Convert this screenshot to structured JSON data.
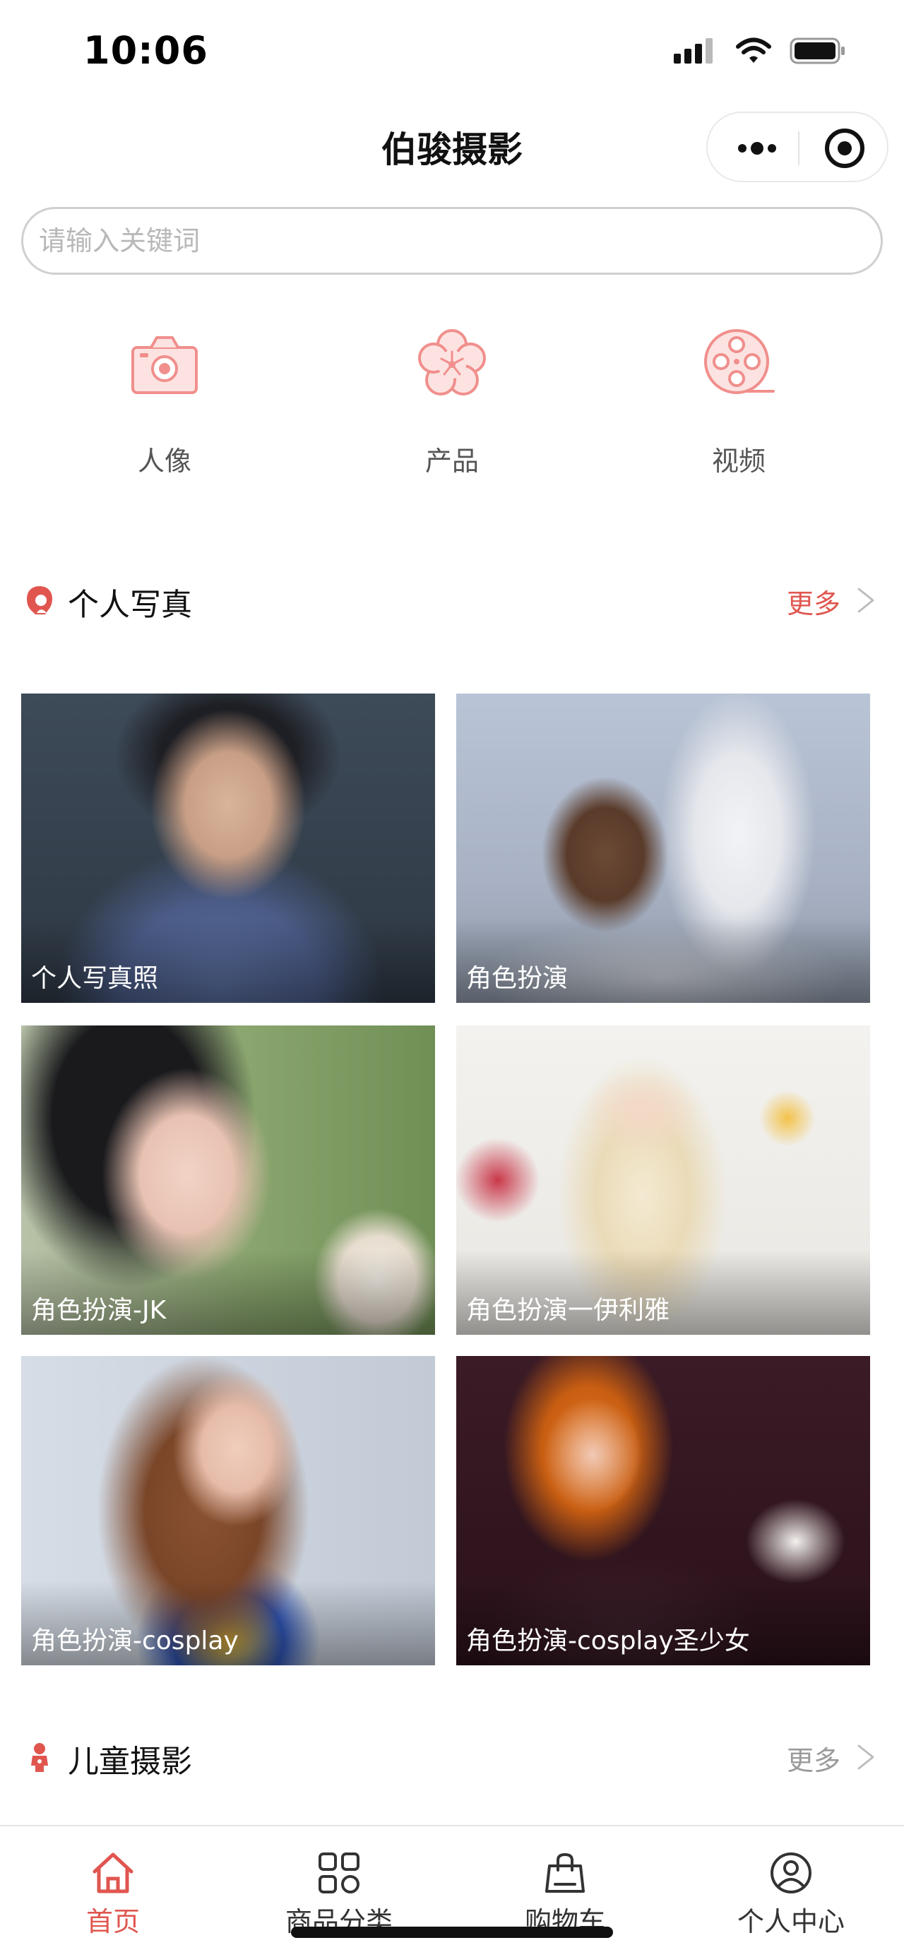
{
  "status_bar": {
    "time": "10:06"
  },
  "nav": {
    "title": "伯骏摄影"
  },
  "search": {
    "placeholder": "请输入关键词"
  },
  "categories": [
    {
      "label": "人像",
      "icon": "camera-icon"
    },
    {
      "label": "产品",
      "icon": "flower-icon"
    },
    {
      "label": "视频",
      "icon": "film-reel-icon"
    }
  ],
  "sections": [
    {
      "title": "个人写真",
      "icon": "portrait-user-icon",
      "more": "更多",
      "more_color": "#e0564f",
      "items": [
        {
          "caption": "个人写真照"
        },
        {
          "caption": "角色扮演"
        },
        {
          "caption": "角色扮演-JK"
        },
        {
          "caption": "角色扮演一伊利雅"
        },
        {
          "caption": "角色扮演-cosplay"
        },
        {
          "caption": "角色扮演-cosplay圣少女"
        }
      ]
    },
    {
      "title": "儿童摄影",
      "icon": "child-icon",
      "more": "更多",
      "more_color": "#9a9a9a"
    }
  ],
  "tab_bar": {
    "active_color": "#e0564f",
    "inactive_color": "#333333",
    "tabs": [
      {
        "label": "首页",
        "icon": "home-icon",
        "active": true
      },
      {
        "label": "商品分类",
        "icon": "grid-icon",
        "active": false
      },
      {
        "label": "购物车",
        "icon": "shopping-bag-icon",
        "active": false
      },
      {
        "label": "个人中心",
        "icon": "user-circle-icon",
        "active": false
      }
    ]
  },
  "colors": {
    "accent": "#e0564f",
    "icon_tint": "#f08f8c"
  }
}
